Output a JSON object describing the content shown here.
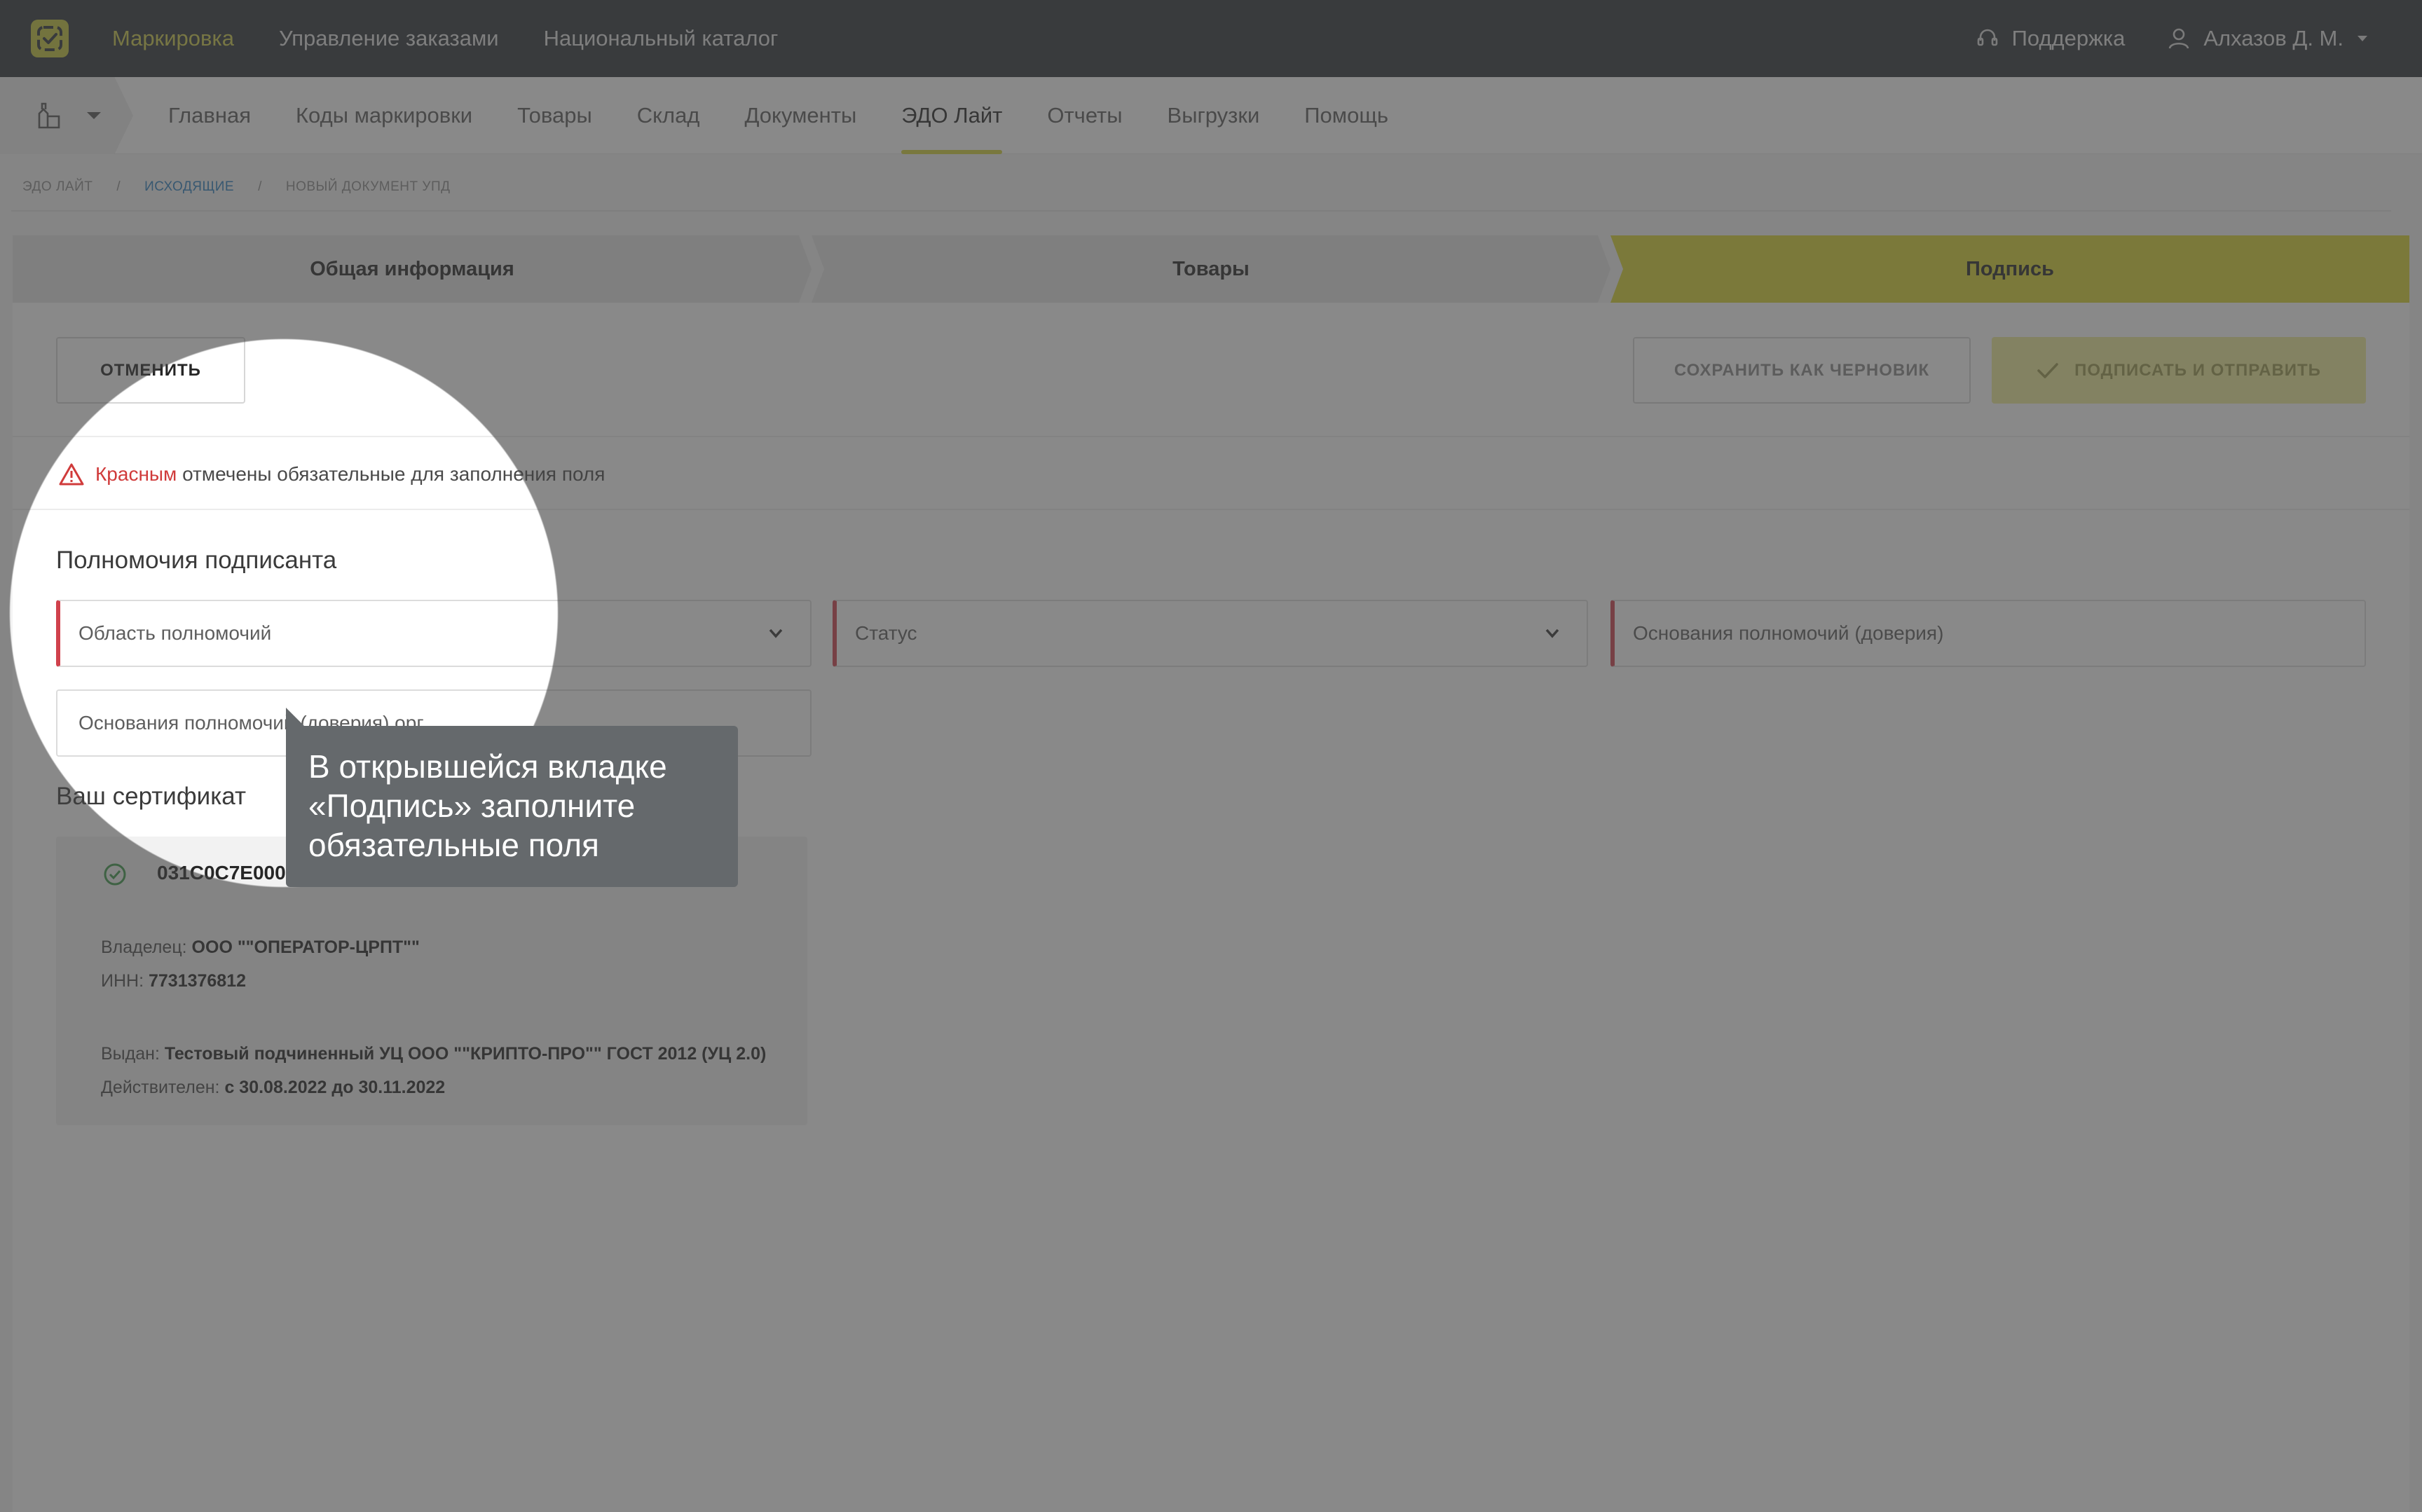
{
  "topbar": {
    "nav": [
      "Маркировка",
      "Управление заказами",
      "Национальный каталог"
    ],
    "support": "Поддержка",
    "user": "Алхазов Д. М."
  },
  "subnav": {
    "items": [
      "Главная",
      "Коды маркировки",
      "Товары",
      "Склад",
      "Документы",
      "ЭДО Лайт",
      "Отчеты",
      "Выгрузки",
      "Помощь"
    ],
    "active": "ЭДО Лайт"
  },
  "breadcrumb": [
    "ЭДО ЛАЙТ",
    "/",
    "ИСХОДЯЩИЕ",
    "/",
    "НОВЫЙ ДОКУМЕНТ УПД"
  ],
  "steps": [
    "Общая информация",
    "Товары",
    "Подпись"
  ],
  "actions": {
    "cancel": "ОТМЕНИТЬ",
    "save_draft": "СОХРАНИТЬ КАК ЧЕРНОВИК",
    "sign_send": "ПОДПИСАТЬ И ОТПРАВИТЬ"
  },
  "warning": {
    "red_word": "Красным",
    "text": "отмечены обязательные для заполнения поля"
  },
  "authority": {
    "title": "Полномочия подписанта",
    "scope_placeholder": "Область полномочий",
    "status_placeholder": "Статус",
    "basis_placeholder": "Основания полномочий (доверия)",
    "org_basis_placeholder": "Основания полномочий (доверия) орг"
  },
  "certificate": {
    "title": "Ваш сертификат",
    "serial": "031C0C7E000",
    "owner_label": "Владелец:",
    "owner": "ООО \"\"ОПЕРАТОР-ЦРПТ\"\"",
    "inn_label": "ИНН:",
    "inn": "7731376812",
    "issuer_label": "Выдан:",
    "issuer": "Тестовый подчиненный УЦ ООО \"\"КРИПТО-ПРО\"\" ГОСТ 2012 (УЦ 2.0)",
    "valid_label": "Действителен:",
    "valid": "с 30.08.2022 до 30.11.2022"
  },
  "tooltip": {
    "line1": "В открывшейся вкладке",
    "line2": "«Подпись» заполните",
    "line3": "обязательные поля"
  },
  "colors": {
    "topbar": "#2d3339",
    "accent": "#d9d631",
    "required": "#d0414c",
    "link": "#2b7fc1"
  }
}
